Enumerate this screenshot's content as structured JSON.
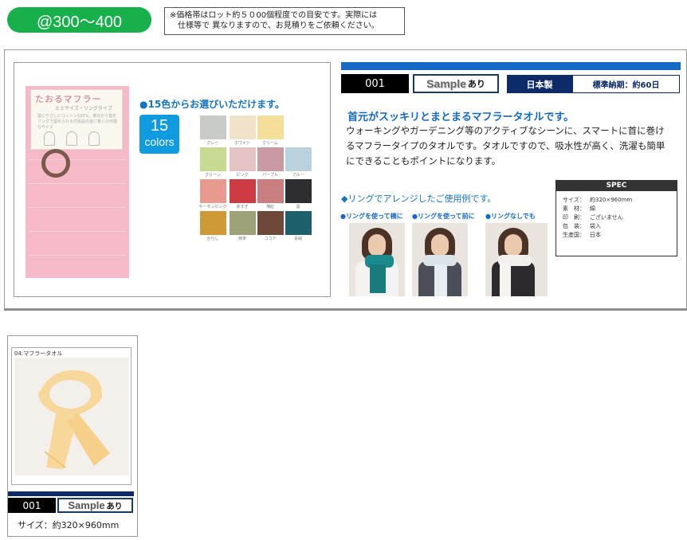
{
  "price_range": "@300～400",
  "notice": {
    "line1": "※価格帯はロット約５０00個程度での目安です。実際には",
    "line2": "仕様等で 異なりますので、お見積りをご依頼ください。"
  },
  "package": {
    "title": "たおるマフラー",
    "subtitle": "ミミサイズ・リングタイプ",
    "body": "首にやさしいコットン100%。車元から首をリングで留められる付属品の首に巻くの可能なサイズ"
  },
  "colors": {
    "intro": "●15色からお選びいただけます。",
    "count": "15",
    "count_word": "colors",
    "swatches": [
      {
        "name": "グレー",
        "hex": "#c9cbc6"
      },
      {
        "name": "ホワイト",
        "hex": "#f1e2c9"
      },
      {
        "name": "クリーム",
        "hex": "#f3de9a"
      },
      {
        "name": "グリーン",
        "hex": "#c8d991"
      },
      {
        "name": "ピンク",
        "hex": "#e6c3c3"
      },
      {
        "name": "パープル",
        "hex": "#c99aa4"
      },
      {
        "name": "ブルー",
        "hex": "#b9d2de"
      },
      {
        "name": "サーモンピンク",
        "hex": "#e89a8e"
      },
      {
        "name": "赤すぎ",
        "hex": "#cf3b43"
      },
      {
        "name": "薄紅",
        "hex": "#c97f80"
      },
      {
        "name": "黒",
        "hex": "#2e2e30"
      },
      {
        "name": "からし",
        "hex": "#cf9a36"
      },
      {
        "name": "抹茶",
        "hex": "#9ea276"
      },
      {
        "name": "ココア",
        "hex": "#6e4838"
      },
      {
        "name": "青緑",
        "hex": "#1d5f6a"
      }
    ]
  },
  "product": {
    "code": "001",
    "sample_word": "Sample",
    "sample_suffix": "あり",
    "made_in": "日本製",
    "lead_time": "標準納期：約60日",
    "headline": "首元がスッキリとまとまるマフラータオルです。",
    "description": "ウォーキングやガーデニング等のアクティブなシーンに、スマートに首に巻けるマフラータイプのタオルです。タオルですので、吸水性が高く、洗濯も簡単にできることもポイントになります。"
  },
  "usage": {
    "title": "◆リングでアレンジしたご使用例です。",
    "examples": [
      {
        "label": "●リングを使って横に",
        "scarf": "#1a8a8c"
      },
      {
        "label": "●リングを使って前に",
        "scarf": "#dce3e6"
      },
      {
        "label": "●リングなしでも",
        "scarf": "#f2f0ec"
      }
    ]
  },
  "spec": {
    "heading": "SPEC",
    "rows": [
      {
        "k": "サイズ：",
        "v": "約320×960mm"
      },
      {
        "k": "素　材：",
        "v": "綿"
      },
      {
        "k": "印　刷：",
        "v": "ございません"
      },
      {
        "k": "包　装：",
        "v": "袋入"
      },
      {
        "k": "生産国：",
        "v": "日本"
      }
    ]
  },
  "small_card": {
    "caption": "04:マフラータオル",
    "code": "001",
    "sample_word": "Sample",
    "sample_suffix": "あり",
    "size": "サイズ：約320×960mm"
  }
}
